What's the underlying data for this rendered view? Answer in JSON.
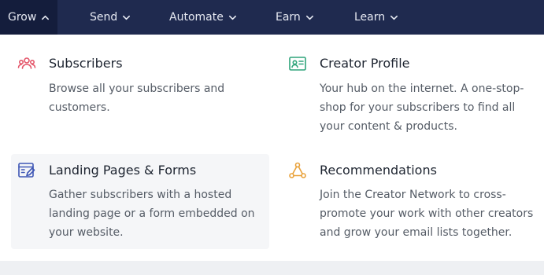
{
  "nav": {
    "items": [
      {
        "label": "Grow"
      },
      {
        "label": "Send"
      },
      {
        "label": "Automate"
      },
      {
        "label": "Earn"
      },
      {
        "label": "Learn"
      }
    ]
  },
  "grow_menu": {
    "items": [
      {
        "title": "Subscribers",
        "description": "Browse all your subscribers and customers.",
        "icon": "users-icon",
        "icon_color": "#e4566a"
      },
      {
        "title": "Creator Profile",
        "description": "Your hub on the internet. A one-stop-shop for your subscribers to find all your content & products.",
        "icon": "id-card-icon",
        "icon_color": "#2ea47a"
      },
      {
        "title": "Landing Pages & Forms",
        "description": "Gather subscribers with a hosted landing page or a form embedded on your website.",
        "icon": "form-edit-icon",
        "icon_color": "#3f57b5"
      },
      {
        "title": "Recommendations",
        "description": "Join the Creator Network to cross-promote your work with other creators and grow your email lists together.",
        "icon": "network-icon",
        "icon_color": "#e9a23b"
      }
    ]
  },
  "colors": {
    "navbar_bg": "#1f2a4f",
    "navbar_active_bg": "#141d3c",
    "panel_bg": "#ffffff",
    "highlight_bg": "#f5f6f8"
  }
}
